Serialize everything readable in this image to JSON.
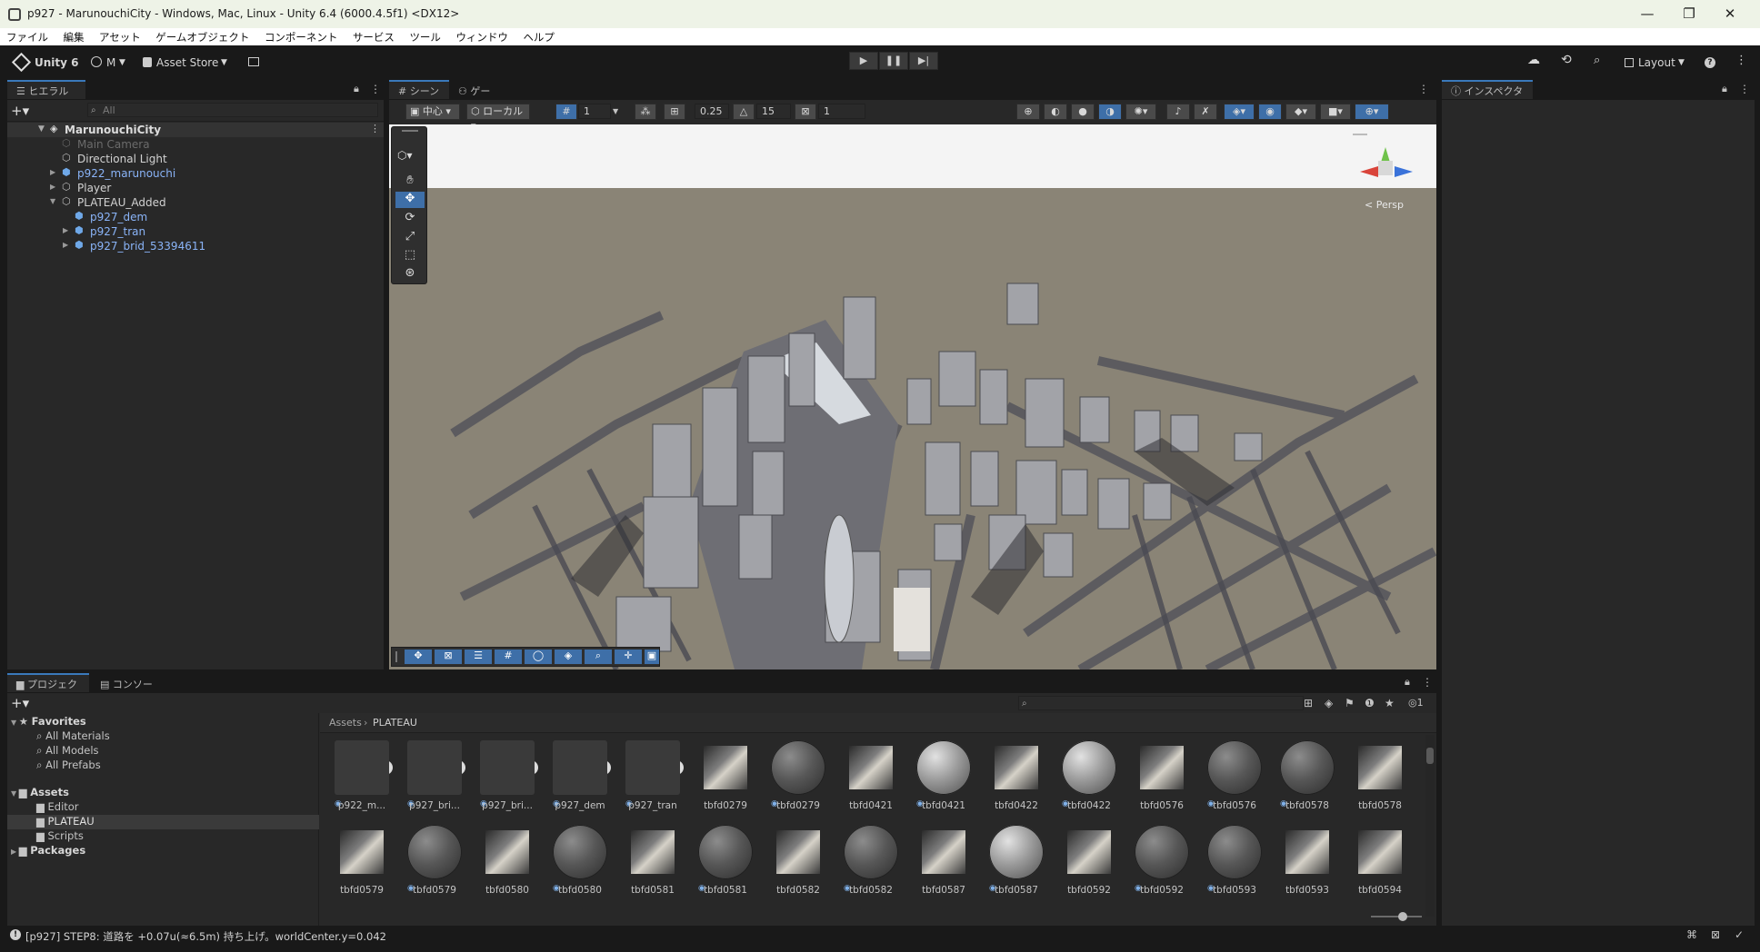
{
  "window": {
    "title": "p927 - MarunouchiCity - Windows, Mac, Linux - Unity 6.4 (6000.4.5f1) <DX12>",
    "minimize": "—",
    "maximize": "❐",
    "close": "✕"
  },
  "menu": [
    "ファイル",
    "編集",
    "アセット",
    "ゲームオブジェクト",
    "コンポーネント",
    "サービス",
    "ツール",
    "ウィンドウ",
    "ヘルプ"
  ],
  "toolbar": {
    "unity_label": "Unity 6",
    "account_label": "M",
    "asset_store_label": "Asset Store",
    "layout_label": "Layout"
  },
  "hierarchy": {
    "tab_label": "ヒエラルキー",
    "search_placeholder": "All",
    "scene_name": "MarunouchiCity",
    "items": [
      {
        "label": "Main Camera",
        "style": "dim"
      },
      {
        "label": "Directional Light",
        "style": "normal"
      },
      {
        "label": "p922_marunouchi",
        "style": "blue"
      },
      {
        "label": "Player",
        "style": "normal"
      },
      {
        "label": "PLATEAU_Added",
        "style": "normal"
      },
      {
        "label": "p927_dem",
        "style": "blue"
      },
      {
        "label": "p927_tran",
        "style": "blue"
      },
      {
        "label": "p927_brid_53394611",
        "style": "blue"
      }
    ]
  },
  "scene": {
    "tab_scene": "シーン",
    "tab_game": "ゲーム",
    "pivot_label": "中心",
    "space_label": "ローカル",
    "grid_value": "1",
    "snap_value": "0.25",
    "rotate_snap": "15",
    "scale_snap": "1",
    "persp_label": "< Persp"
  },
  "inspector": {
    "tab_label": "インスペクター"
  },
  "project": {
    "tab_project": "プロジェクト",
    "tab_console": "コンソール",
    "breadcrumb": [
      "Assets",
      "PLATEAU"
    ],
    "hidden_count": "1",
    "favorites_label": "Favorites",
    "favorites": [
      "All Materials",
      "All Models",
      "All Prefabs"
    ],
    "assets_label": "Assets",
    "asset_folders": [
      "Editor",
      "PLATEAU",
      "Scripts"
    ],
    "packages_label": "Packages",
    "grid": [
      {
        "label": "p922_m...",
        "kind": "model",
        "badge": true
      },
      {
        "label": "p927_bri...",
        "kind": "model",
        "badge": true
      },
      {
        "label": "p927_bri...",
        "kind": "model",
        "badge": true
      },
      {
        "label": "p927_dem",
        "kind": "model",
        "badge": true
      },
      {
        "label": "p927_tran",
        "kind": "model",
        "badge": true
      },
      {
        "label": "tbfd0279",
        "kind": "texture",
        "badge": false
      },
      {
        "label": "tbfd0279",
        "kind": "material",
        "badge": true
      },
      {
        "label": "tbfd0421",
        "kind": "texture",
        "badge": false
      },
      {
        "label": "tbfd0421",
        "kind": "material-silver",
        "badge": true
      },
      {
        "label": "tbfd0422",
        "kind": "texture",
        "badge": false
      },
      {
        "label": "tbfd0422",
        "kind": "material-silver",
        "badge": true
      },
      {
        "label": "tbfd0576",
        "kind": "texture",
        "badge": false
      },
      {
        "label": "tbfd0576",
        "kind": "material",
        "badge": true
      },
      {
        "label": "tbfd0578",
        "kind": "material",
        "badge": true
      },
      {
        "label": "tbfd0578",
        "kind": "texture",
        "badge": false
      },
      {
        "label": "tbfd0579",
        "kind": "texture",
        "badge": false
      },
      {
        "label": "tbfd0579",
        "kind": "material",
        "badge": true
      },
      {
        "label": "tbfd0580",
        "kind": "texture",
        "badge": false
      },
      {
        "label": "tbfd0580",
        "kind": "material",
        "badge": true
      },
      {
        "label": "tbfd0581",
        "kind": "texture",
        "badge": false
      },
      {
        "label": "tbfd0581",
        "kind": "material",
        "badge": true
      },
      {
        "label": "tbfd0582",
        "kind": "texture",
        "badge": false
      },
      {
        "label": "tbfd0582",
        "kind": "material",
        "badge": true
      },
      {
        "label": "tbfd0587",
        "kind": "texture",
        "badge": false
      },
      {
        "label": "tbfd0587",
        "kind": "material-silver",
        "badge": true
      },
      {
        "label": "tbfd0592",
        "kind": "texture",
        "badge": false
      },
      {
        "label": "tbfd0592",
        "kind": "material",
        "badge": true
      },
      {
        "label": "tbfd0593",
        "kind": "material",
        "badge": true
      },
      {
        "label": "tbfd0593",
        "kind": "texture",
        "badge": false
      },
      {
        "label": "tbfd0594",
        "kind": "texture",
        "badge": false
      }
    ]
  },
  "status": {
    "message": "[p927] STEP8: 道路を +0.07u(≈6.5m) 持ち上げ。worldCenter.y=0.042"
  }
}
